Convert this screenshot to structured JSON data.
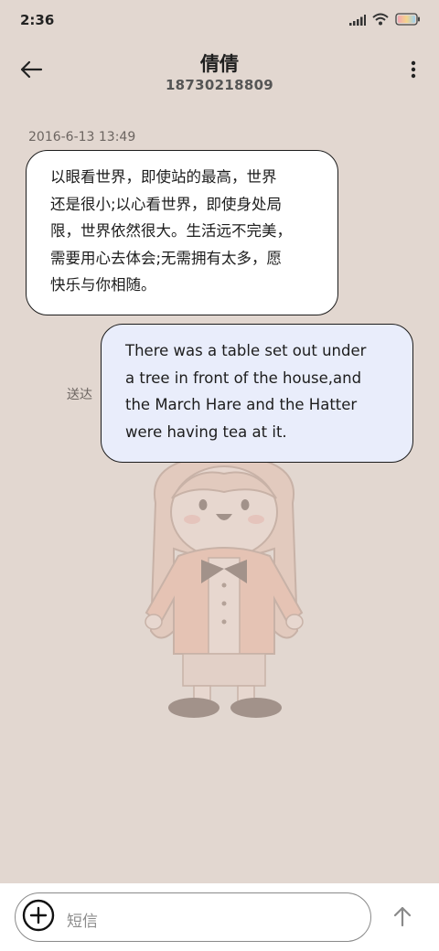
{
  "status_bar": {
    "time": "2:36",
    "icons": [
      "signal-icon",
      "wifi-icon",
      "battery-icon"
    ]
  },
  "header": {
    "contact_name": "倩倩",
    "phone_number": "18730218809",
    "icons": [
      "back-arrow-icon",
      "more-vertical-icon"
    ]
  },
  "conversation": {
    "timestamp": "2016-6-13 13:49",
    "incoming": {
      "lines": [
        "以眼看世界，即使站的最高，世界",
        "还是很小;以心看世界，即使身处局",
        "限，世界依然很大。生活远不完美，",
        "需要用心去体会;无需拥有太多，愿",
        "快乐与你相随。"
      ]
    },
    "outgoing": {
      "lines": [
        "There was a table set out under",
        "a tree in front of the house,and",
        "the March Hare and the Hatter",
        "were having tea at it."
      ],
      "status": "送达"
    }
  },
  "compose": {
    "placeholder": "短信",
    "icons": [
      "add-circle-icon",
      "send-arrow-up-icon"
    ]
  },
  "colors": {
    "background": "#e2d7d0",
    "incoming_bubble": "#ffffff",
    "outgoing_bubble": "#e9edfb",
    "bubble_border": "#1c1c1c"
  }
}
